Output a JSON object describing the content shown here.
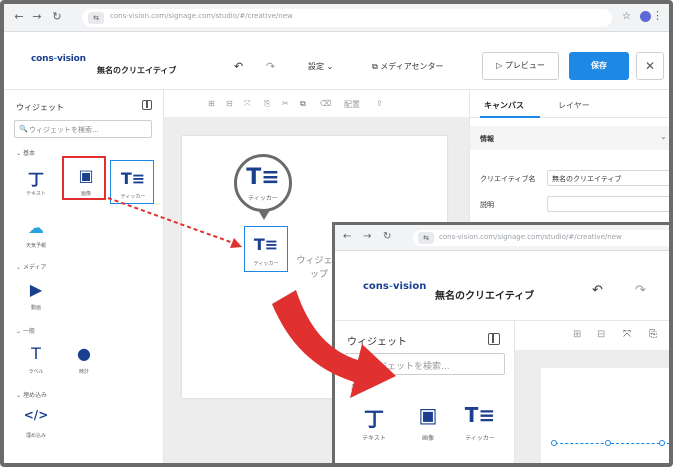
{
  "browser": {
    "url": "cons-vision.com/signage.com/studio/#/creative/new",
    "site_label": "⇆"
  },
  "header": {
    "logo_main": "cons",
    "logo_mid": "-",
    "logo_end": "vision",
    "creative_title": "無名のクリエイティブ",
    "settings_label": "設定",
    "media_center_label": "メディアセンター",
    "preview_label": "プレビュー",
    "save_label": "保存"
  },
  "left_panel": {
    "title": "ウィジェット",
    "search_placeholder": "ウィジェットを検索...",
    "sections": {
      "basic": "基本",
      "media": "メディア",
      "general": "一般",
      "embed": "埋め込み"
    },
    "widgets": {
      "text": "テキスト",
      "image": "画像",
      "ticker": "ティッカー",
      "weather": "天気予報",
      "video": "動画",
      "label": "ラベル",
      "clock": "時計",
      "embed": "埋め込み"
    }
  },
  "toolbar": {
    "arrange_label": "配置"
  },
  "right_panel": {
    "tab_canvas": "キャンバス",
    "tab_layer": "レイヤー",
    "section_info": "情報",
    "creative_name_label": "クリエイティブ名",
    "creative_name_value": "無名のクリエイティブ",
    "description_label": "説明"
  },
  "callout": {
    "ticker_label": "ティッカー",
    "drop_hint": "ウィジェット\nップ"
  },
  "inset": {
    "url": "cons-vision.com/signage.com/studio/#/creative/new",
    "creative_title": "無名のクリエイティブ",
    "widget_title": "ウィジェット",
    "search_placeholder": "ウィジェットを検索...",
    "section_basic": "基本",
    "text_label": "テキスト",
    "image_label": "画像",
    "ticker_label": "ティッカー"
  },
  "colors": {
    "brand": "#1b3f8f",
    "accent": "#29a3e0",
    "primary": "#1e88e5",
    "highlight_red": "#e0302f"
  }
}
